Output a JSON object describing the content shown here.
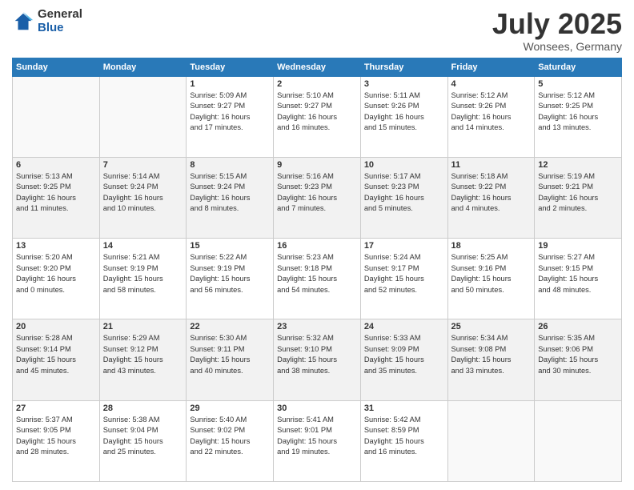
{
  "logo": {
    "general": "General",
    "blue": "Blue"
  },
  "title": "July 2025",
  "location": "Wonsees, Germany",
  "days_header": [
    "Sunday",
    "Monday",
    "Tuesday",
    "Wednesday",
    "Thursday",
    "Friday",
    "Saturday"
  ],
  "weeks": [
    [
      {
        "day": "",
        "info": ""
      },
      {
        "day": "",
        "info": ""
      },
      {
        "day": "1",
        "info": "Sunrise: 5:09 AM\nSunset: 9:27 PM\nDaylight: 16 hours\nand 17 minutes."
      },
      {
        "day": "2",
        "info": "Sunrise: 5:10 AM\nSunset: 9:27 PM\nDaylight: 16 hours\nand 16 minutes."
      },
      {
        "day": "3",
        "info": "Sunrise: 5:11 AM\nSunset: 9:26 PM\nDaylight: 16 hours\nand 15 minutes."
      },
      {
        "day": "4",
        "info": "Sunrise: 5:12 AM\nSunset: 9:26 PM\nDaylight: 16 hours\nand 14 minutes."
      },
      {
        "day": "5",
        "info": "Sunrise: 5:12 AM\nSunset: 9:25 PM\nDaylight: 16 hours\nand 13 minutes."
      }
    ],
    [
      {
        "day": "6",
        "info": "Sunrise: 5:13 AM\nSunset: 9:25 PM\nDaylight: 16 hours\nand 11 minutes."
      },
      {
        "day": "7",
        "info": "Sunrise: 5:14 AM\nSunset: 9:24 PM\nDaylight: 16 hours\nand 10 minutes."
      },
      {
        "day": "8",
        "info": "Sunrise: 5:15 AM\nSunset: 9:24 PM\nDaylight: 16 hours\nand 8 minutes."
      },
      {
        "day": "9",
        "info": "Sunrise: 5:16 AM\nSunset: 9:23 PM\nDaylight: 16 hours\nand 7 minutes."
      },
      {
        "day": "10",
        "info": "Sunrise: 5:17 AM\nSunset: 9:23 PM\nDaylight: 16 hours\nand 5 minutes."
      },
      {
        "day": "11",
        "info": "Sunrise: 5:18 AM\nSunset: 9:22 PM\nDaylight: 16 hours\nand 4 minutes."
      },
      {
        "day": "12",
        "info": "Sunrise: 5:19 AM\nSunset: 9:21 PM\nDaylight: 16 hours\nand 2 minutes."
      }
    ],
    [
      {
        "day": "13",
        "info": "Sunrise: 5:20 AM\nSunset: 9:20 PM\nDaylight: 16 hours\nand 0 minutes."
      },
      {
        "day": "14",
        "info": "Sunrise: 5:21 AM\nSunset: 9:19 PM\nDaylight: 15 hours\nand 58 minutes."
      },
      {
        "day": "15",
        "info": "Sunrise: 5:22 AM\nSunset: 9:19 PM\nDaylight: 15 hours\nand 56 minutes."
      },
      {
        "day": "16",
        "info": "Sunrise: 5:23 AM\nSunset: 9:18 PM\nDaylight: 15 hours\nand 54 minutes."
      },
      {
        "day": "17",
        "info": "Sunrise: 5:24 AM\nSunset: 9:17 PM\nDaylight: 15 hours\nand 52 minutes."
      },
      {
        "day": "18",
        "info": "Sunrise: 5:25 AM\nSunset: 9:16 PM\nDaylight: 15 hours\nand 50 minutes."
      },
      {
        "day": "19",
        "info": "Sunrise: 5:27 AM\nSunset: 9:15 PM\nDaylight: 15 hours\nand 48 minutes."
      }
    ],
    [
      {
        "day": "20",
        "info": "Sunrise: 5:28 AM\nSunset: 9:14 PM\nDaylight: 15 hours\nand 45 minutes."
      },
      {
        "day": "21",
        "info": "Sunrise: 5:29 AM\nSunset: 9:12 PM\nDaylight: 15 hours\nand 43 minutes."
      },
      {
        "day": "22",
        "info": "Sunrise: 5:30 AM\nSunset: 9:11 PM\nDaylight: 15 hours\nand 40 minutes."
      },
      {
        "day": "23",
        "info": "Sunrise: 5:32 AM\nSunset: 9:10 PM\nDaylight: 15 hours\nand 38 minutes."
      },
      {
        "day": "24",
        "info": "Sunrise: 5:33 AM\nSunset: 9:09 PM\nDaylight: 15 hours\nand 35 minutes."
      },
      {
        "day": "25",
        "info": "Sunrise: 5:34 AM\nSunset: 9:08 PM\nDaylight: 15 hours\nand 33 minutes."
      },
      {
        "day": "26",
        "info": "Sunrise: 5:35 AM\nSunset: 9:06 PM\nDaylight: 15 hours\nand 30 minutes."
      }
    ],
    [
      {
        "day": "27",
        "info": "Sunrise: 5:37 AM\nSunset: 9:05 PM\nDaylight: 15 hours\nand 28 minutes."
      },
      {
        "day": "28",
        "info": "Sunrise: 5:38 AM\nSunset: 9:04 PM\nDaylight: 15 hours\nand 25 minutes."
      },
      {
        "day": "29",
        "info": "Sunrise: 5:40 AM\nSunset: 9:02 PM\nDaylight: 15 hours\nand 22 minutes."
      },
      {
        "day": "30",
        "info": "Sunrise: 5:41 AM\nSunset: 9:01 PM\nDaylight: 15 hours\nand 19 minutes."
      },
      {
        "day": "31",
        "info": "Sunrise: 5:42 AM\nSunset: 8:59 PM\nDaylight: 15 hours\nand 16 minutes."
      },
      {
        "day": "",
        "info": ""
      },
      {
        "day": "",
        "info": ""
      }
    ]
  ]
}
